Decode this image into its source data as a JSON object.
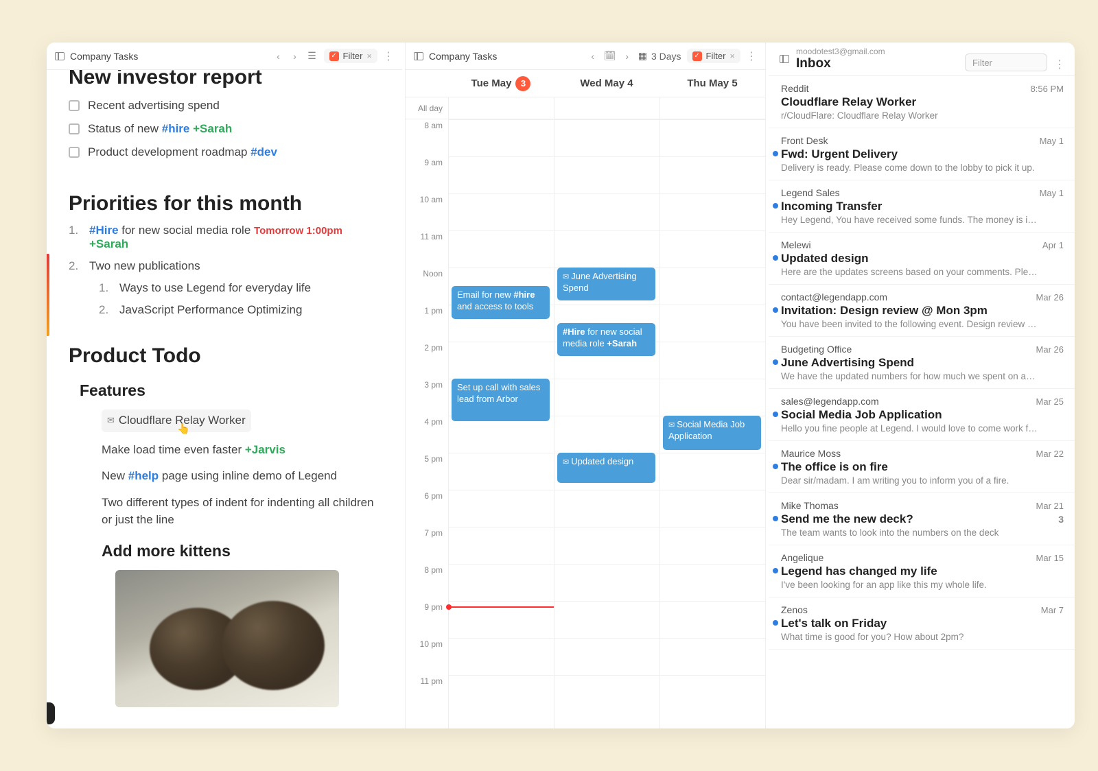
{
  "leftPane": {
    "toolbar": {
      "title": "Company Tasks",
      "filterLabel": "Filter"
    },
    "headingCut": "New investor report",
    "checks": [
      "Recent advertising spend",
      "Status of new #hire +Sarah",
      "Product development roadmap #dev"
    ],
    "check2_pre": "Status of new ",
    "check2_tag": "#hire",
    "check2_post": " +Sarah",
    "check3_pre": "Product development roadmap ",
    "check3_tag": "#dev",
    "h2": "Priorities for this month",
    "pri1_tag": "#Hire",
    "pri1_text": " for new social media role  ",
    "pri1_time": "Tomorrow 1:00pm",
    "pri1_assign": "+Sarah",
    "pri2": "Two new publications",
    "pri2a": "Ways to use Legend for everyday life",
    "pri2b": "JavaScript Performance Optimizing",
    "h3": "Product Todo",
    "h4a": "Features",
    "feat_link": "Cloudflare Relay Worker",
    "feat2_pre": "Make load time even faster ",
    "feat2_assign": "+Jarvis",
    "feat3_pre": "New ",
    "feat3_tag": "#help",
    "feat3_post": " page using inline demo of Legend",
    "feat4": "Two different types of indent for indenting all children or just the line",
    "h4b": "Add more kittens"
  },
  "calPane": {
    "toolbar": {
      "title": "Company Tasks",
      "rangeLabel": "3 Days",
      "filterLabel": "Filter"
    },
    "days": [
      {
        "label": "Tue May",
        "badge": "3"
      },
      {
        "label": "Wed May 4"
      },
      {
        "label": "Thu May 5"
      }
    ],
    "allDayLabel": "All day",
    "hours": [
      "8 am",
      "9 am",
      "10 am",
      "11 am",
      "Noon",
      "1 pm",
      "2 pm",
      "3 pm",
      "4 pm",
      "5 pm",
      "6 pm",
      "7 pm",
      "8 pm",
      "9 pm",
      "10 pm",
      "11 pm"
    ],
    "nowHourIndex": 13.15,
    "events": {
      "tue_email_pre": "Email for new ",
      "tue_email_tag": "#hire",
      "tue_email_post": " and access to tools",
      "tue_call": "Set up call with sales lead from Arbor",
      "wed_spend": "June Advertising Spend",
      "wed_hire_tag": "#Hire",
      "wed_hire_text": " for new social media role  ",
      "wed_hire_assign": "+Sarah",
      "wed_design": "Updated design",
      "thu_job": "Social Media Job Application"
    }
  },
  "inbox": {
    "account": "moodotest3@gmail.com",
    "title": "Inbox",
    "filterPlaceholder": "Filter",
    "mails": [
      {
        "from": "Reddit",
        "when": "8:56 PM",
        "subj": "Cloudflare Relay Worker",
        "prev": "r/CloudFlare: Cloudflare Relay Worker",
        "unread": false
      },
      {
        "from": "Front Desk",
        "when": "May 1",
        "subj": "Fwd: Urgent Delivery",
        "prev": "Delivery is ready. Please come down to the lobby to pick it up.",
        "unread": true
      },
      {
        "from": "Legend Sales",
        "when": "May 1",
        "subj": "Incoming Transfer",
        "prev": "Hey Legend, You have received some funds. The money is i…",
        "unread": true
      },
      {
        "from": "Melewi",
        "when": "Apr 1",
        "subj": "Updated design",
        "prev": "Here are the updates screens based on your comments. Ple…",
        "unread": true
      },
      {
        "from": "contact@legendapp.com",
        "when": "Mar 26",
        "subj": "Invitation: Design review @ Mon 3pm",
        "prev": "You have been invited to the following event. Design review …",
        "unread": true
      },
      {
        "from": "Budgeting Office",
        "when": "Mar 26",
        "subj": "June Advertising Spend",
        "prev": "We have the updated numbers for how much we spent on a…",
        "unread": true
      },
      {
        "from": "sales@legendapp.com",
        "when": "Mar 25",
        "subj": "Social Media Job Application",
        "prev": "Hello you fine people at Legend. I would love to come work f…",
        "unread": true
      },
      {
        "from": "Maurice Moss",
        "when": "Mar 22",
        "subj": "The office is on fire",
        "prev": "Dear sir/madam. I am writing you to inform you of a fire.",
        "unread": true
      },
      {
        "from": "Mike Thomas",
        "when": "Mar 21",
        "subj": "Send me the new deck?",
        "prev": "The team wants to look into the numbers on the deck",
        "unread": true,
        "count": "3"
      },
      {
        "from": "Angelique",
        "when": "Mar 15",
        "subj": "Legend has changed my life",
        "prev": "I've been looking for an app like this my whole life.",
        "unread": true
      },
      {
        "from": "Zenos",
        "when": "Mar 7",
        "subj": "Let's talk on Friday",
        "prev": "What time is good for you? How about 2pm?",
        "unread": true
      }
    ]
  }
}
